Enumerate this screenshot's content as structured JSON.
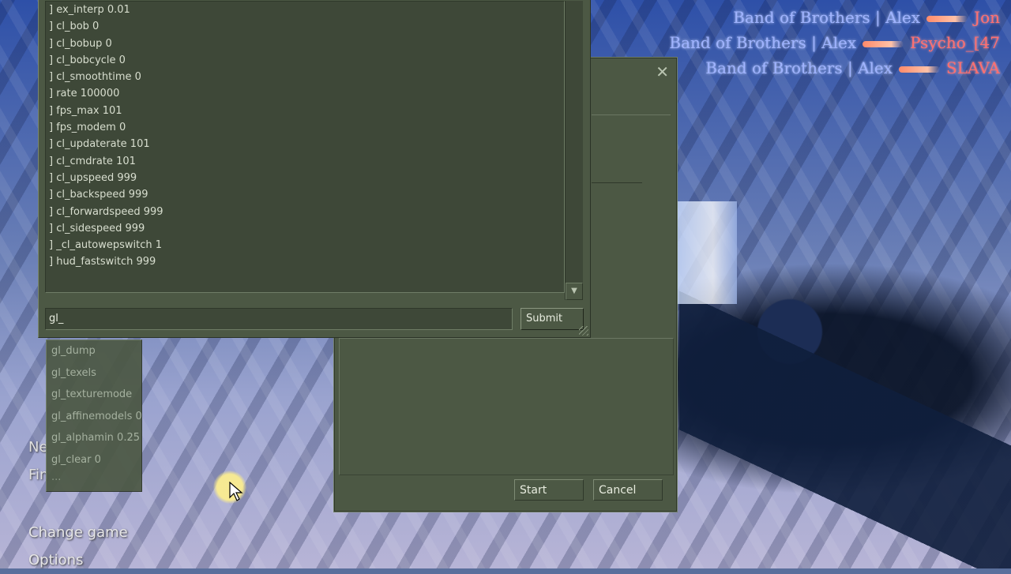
{
  "killfeed": [
    {
      "attacker": "Band of Brothers | Alex",
      "victim": "Jon"
    },
    {
      "attacker": "Band of Brothers | Alex",
      "victim": "Psycho_[47"
    },
    {
      "attacker": "Band of Brothers | Alex",
      "victim": "SLAVA"
    }
  ],
  "console": {
    "log": [
      "] ex_interp 0.01",
      "] cl_bob 0",
      "] cl_bobup 0",
      "] cl_bobcycle 0",
      "] cl_smoothtime 0",
      "] rate 100000",
      "] fps_max 101",
      "] fps_modem 0",
      "] cl_updaterate 101",
      "] cl_cmdrate 101",
      "] cl_upspeed 999",
      "] cl_backspeed 999",
      "] cl_forwardspeed 999",
      "] cl_sidespeed 999",
      "] _cl_autowepswitch 1",
      "] hud_fastswitch 999"
    ],
    "input_value": "gl_",
    "submit_label": "Submit",
    "scroll_down_glyph": "▼"
  },
  "autocomplete": {
    "items": [
      "gl_dump",
      "gl_texels",
      "gl_texturemode",
      "gl_affinemodels 0",
      "gl_alphamin 0.25",
      "gl_clear 0"
    ],
    "more": "..."
  },
  "dialog": {
    "close_glyph": "✕",
    "start_label": "Start",
    "cancel_label": "Cancel"
  },
  "main_menu": {
    "partial_1": "Ne",
    "partial_2": "Fin",
    "items": [
      "Change game",
      "Options"
    ]
  }
}
